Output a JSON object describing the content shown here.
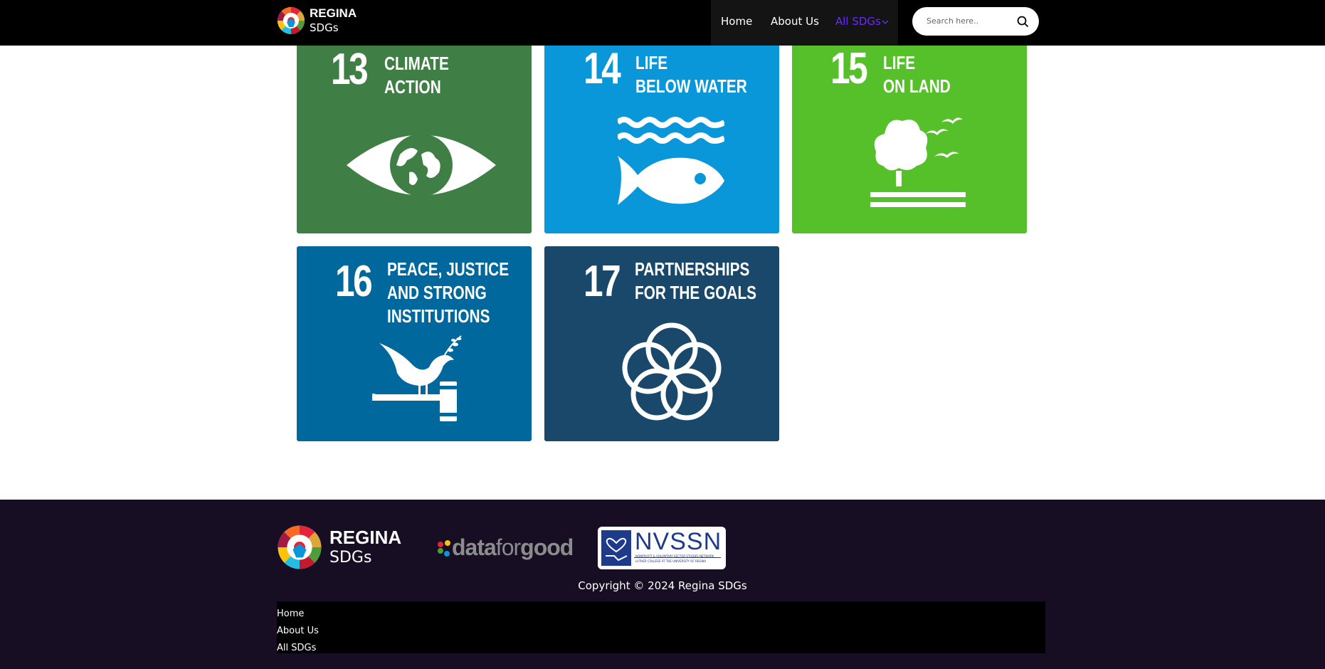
{
  "header": {
    "brand_line1": "REGINA",
    "brand_line2": "SDGs",
    "nav": [
      {
        "label": "Home"
      },
      {
        "label": "About Us"
      },
      {
        "label": "All SDGs"
      }
    ],
    "search_placeholder": "Search here.."
  },
  "tiles": [
    {
      "number": "13",
      "title_line1": "CLIMATE",
      "title_line2": "ACTION",
      "color": "#3f7e44",
      "icon": "eye-globe-icon"
    },
    {
      "number": "14",
      "title_line1": "LIFE",
      "title_line2": "BELOW WATER",
      "color": "#0a97d9",
      "icon": "fish-water-icon"
    },
    {
      "number": "15",
      "title_line1": "LIFE",
      "title_line2": "ON LAND",
      "color": "#56c02b",
      "icon": "tree-birds-icon"
    },
    {
      "number": "16",
      "title_line1": "PEACE, JUSTICE",
      "title_line2": "AND STRONG",
      "title_line3": "INSTITUTIONS",
      "color": "#00689d",
      "icon": "dove-gavel-icon"
    },
    {
      "number": "17",
      "title_line1": "PARTNERSHIPS",
      "title_line2": "FOR THE GOALS",
      "color": "#19486a",
      "icon": "rings-icon"
    }
  ],
  "footer": {
    "brand_line1": "REGINA",
    "brand_line2": "SDGs",
    "partner1_a": "data",
    "partner1_b": "for",
    "partner1_c": "good",
    "partner2": "NVSSN",
    "partner2_sub": "NONPROFIT & VOLUNTARY SECTOR STUDIES NETWORK",
    "partner2_sub2": "LUTHER COLLEGE AT THE UNIVERSITY OF REGINA",
    "copyright": "Copyright © 2024 Regina SDGs",
    "links": [
      {
        "label": "Home"
      },
      {
        "label": "About Us"
      },
      {
        "label": "All SDGs"
      }
    ]
  }
}
